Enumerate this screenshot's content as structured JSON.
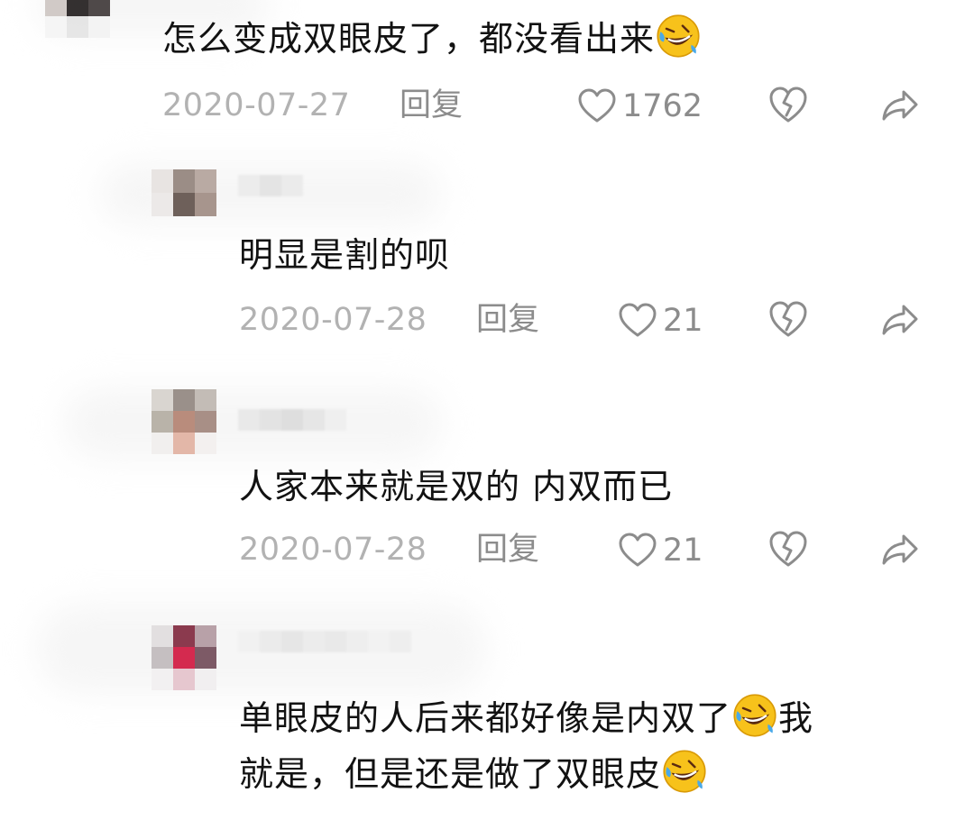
{
  "comments": [
    {
      "text": "怎么变成双眼皮了，都没看出来",
      "date": "2020-07-27",
      "reply_label": "回复",
      "likes": "1762",
      "emoji": "rolling-on-floor-laughing-icon"
    },
    {
      "text": "明显是割的呗",
      "date": "2020-07-28",
      "reply_label": "回复",
      "likes": "21"
    },
    {
      "text": "人家本来就是双的 内双而已",
      "date": "2020-07-28",
      "reply_label": "回复",
      "likes": "21"
    },
    {
      "line1_a": "单眼皮的人后来都好像是内双了",
      "line1_b": "我",
      "line2": "就是，但是还是做了双眼皮",
      "emoji": "rolling-on-floor-laughing-icon"
    }
  ],
  "colors": {
    "text": "#121212",
    "date": "#b2b2b2",
    "meta": "#8c8c8c",
    "emoji_face": "#f7c21b"
  }
}
